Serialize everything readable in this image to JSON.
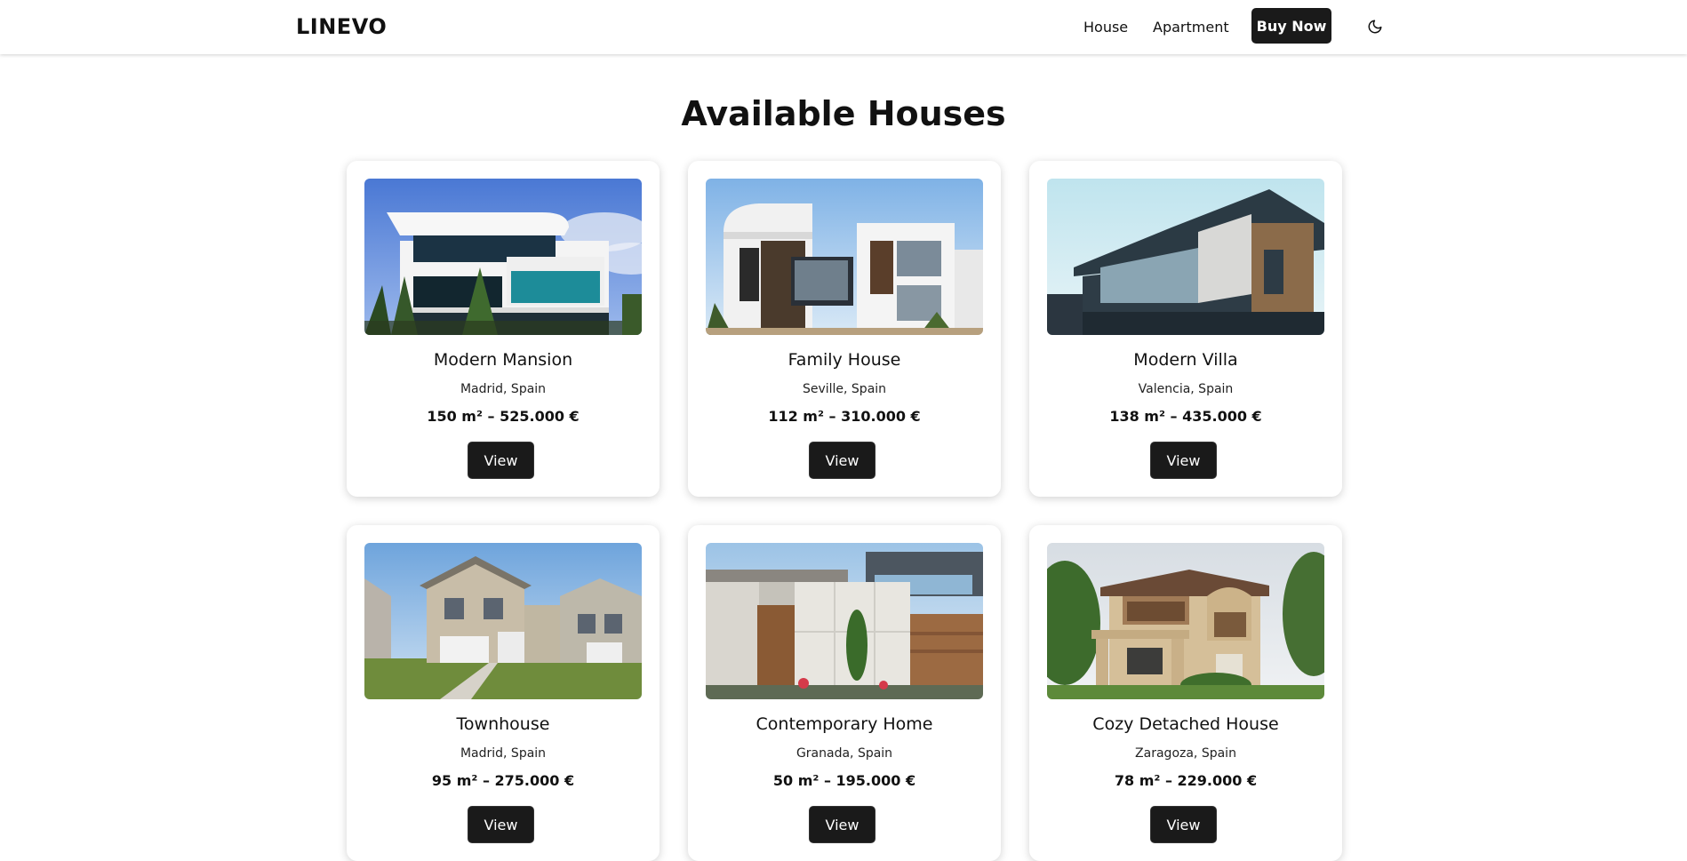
{
  "navbar": {
    "brand": "LINEVO",
    "links": [
      "House",
      "Apartment"
    ],
    "cta_label": "Buy Now",
    "theme_icon": "moon-icon"
  },
  "page": {
    "title": "Available Houses"
  },
  "houses": [
    {
      "title": "Modern Mansion",
      "location": "Madrid, Spain",
      "price": "150 m² – 525.000 €",
      "button": "View"
    },
    {
      "title": "Family House",
      "location": "Seville, Spain",
      "price": "112 m² – 310.000 €",
      "button": "View"
    },
    {
      "title": "Modern Villa",
      "location": "Valencia, Spain",
      "price": "138 m² – 435.000 €",
      "button": "View"
    },
    {
      "title": "Townhouse",
      "location": "Madrid, Spain",
      "price": "95 m² – 275.000 €",
      "button": "View"
    },
    {
      "title": "Contemporary Home",
      "location": "Granada, Spain",
      "price": "50 m² – 195.000 €",
      "button": "View"
    },
    {
      "title": "Cozy Detached House",
      "location": "Zaragoza, Spain",
      "price": "78 m² – 229.000 €",
      "button": "View"
    }
  ],
  "colors": {
    "button_bg": "#1a1a1a",
    "page_bg": "#ffffff",
    "text": "#111111"
  }
}
